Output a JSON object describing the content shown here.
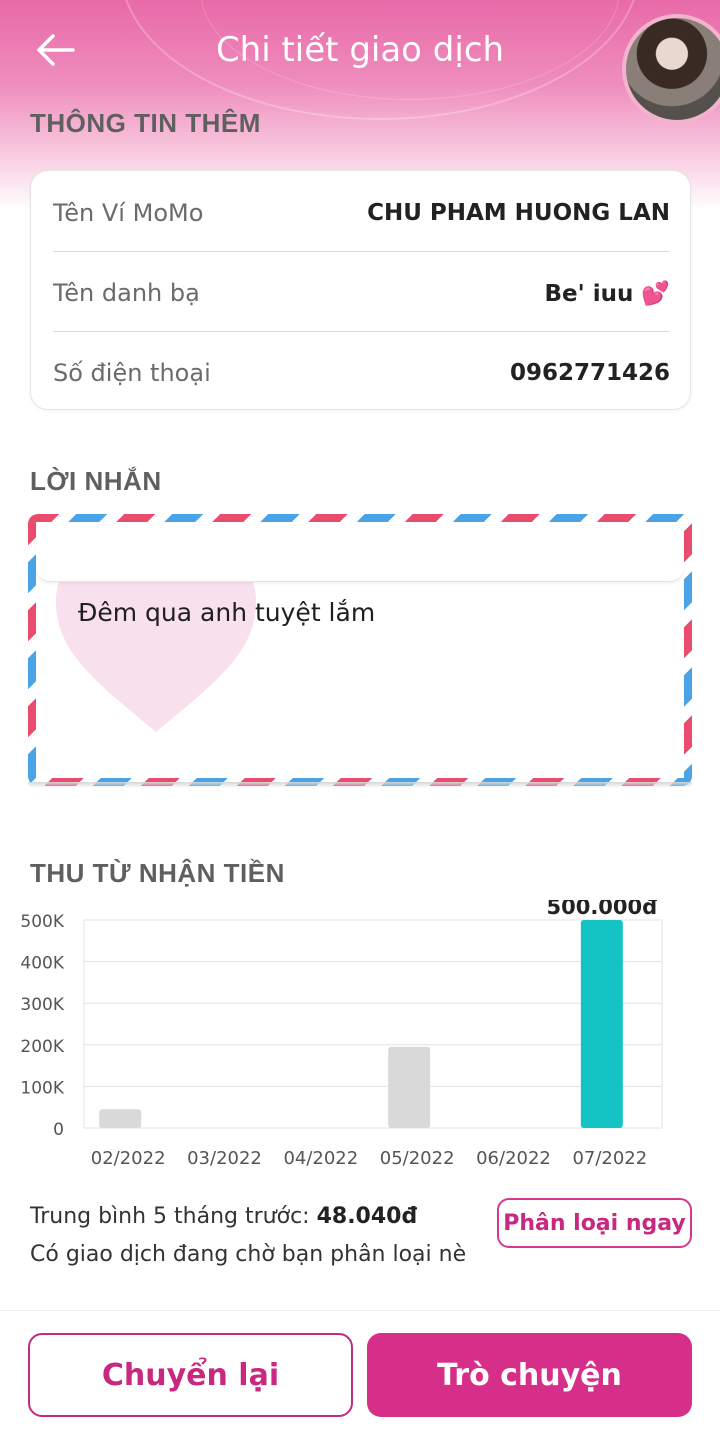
{
  "header": {
    "title": "Chi tiết giao dịch",
    "back_icon": "arrow-left-icon"
  },
  "info": {
    "section_title": "THÔNG TIN THÊM",
    "rows": [
      {
        "label": "Tên Ví MoMo",
        "value": "CHU PHAM HUONG LAN"
      },
      {
        "label": "Tên danh bạ",
        "value": "Be' iuu 💕"
      },
      {
        "label": "Số điện thoại",
        "value": "0962771426"
      }
    ]
  },
  "message": {
    "section_title": "LỜI NHẮN",
    "text": "Đêm qua anh tuyệt lắm"
  },
  "income": {
    "section_title": "THU TỪ NHẬN TIỀN",
    "average_label": "Trung bình 5 tháng trước:",
    "average_value": "48.040đ",
    "pending_text": "Có giao dịch đang chờ bạn phân loại nè",
    "classify_button": "Phân loại ngay"
  },
  "actions": {
    "resend_label": "Chuyển lại",
    "chat_label": "Trò chuyện"
  },
  "colors": {
    "brand": "#d62f8a",
    "highlight_bar": "#14c4c4",
    "past_bar": "#d9d9d9"
  },
  "chart_data": {
    "type": "bar",
    "categories": [
      "02/2022",
      "03/2022",
      "04/2022",
      "05/2022",
      "06/2022",
      "07/2022"
    ],
    "values": [
      45000,
      0,
      0,
      195000,
      0,
      500000
    ],
    "ylim": [
      0,
      500000
    ],
    "yticks": [
      {
        "value": 0,
        "label": "0"
      },
      {
        "value": 100000,
        "label": "100K"
      },
      {
        "value": 200000,
        "label": "200K"
      },
      {
        "value": 300000,
        "label": "300K"
      },
      {
        "value": 400000,
        "label": "400K"
      },
      {
        "value": 500000,
        "label": "500K"
      }
    ],
    "highlight_index": 5,
    "highlight_label": "500.000đ",
    "grid": true
  }
}
